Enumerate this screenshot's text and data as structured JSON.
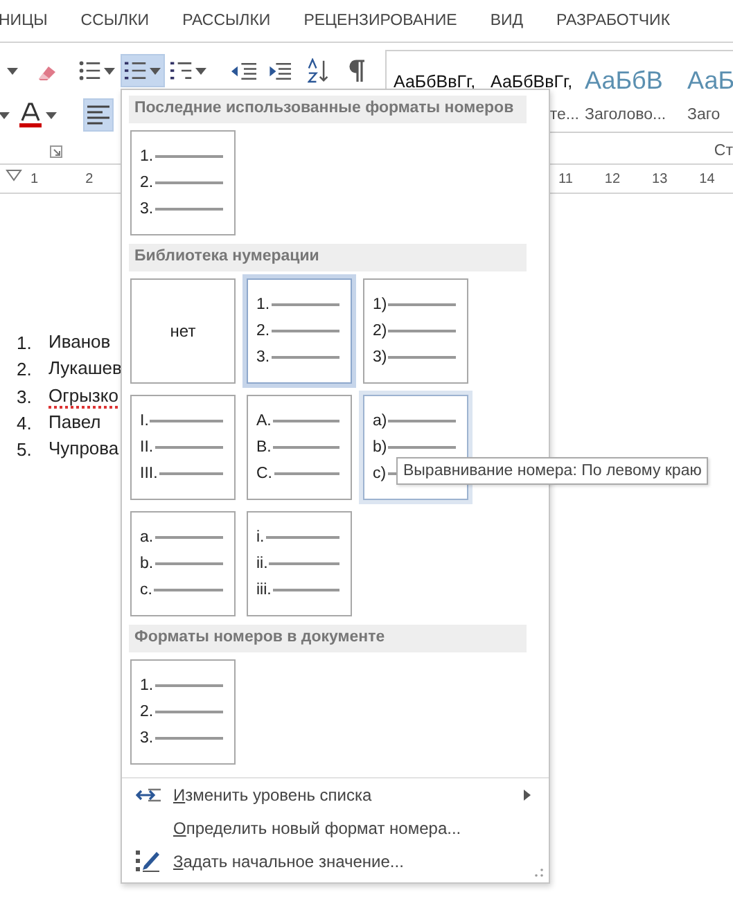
{
  "ribbon_tabs": [
    {
      "label": "НИЦЫ"
    },
    {
      "label": "ССЫЛКИ"
    },
    {
      "label": "РАССЫЛКИ"
    },
    {
      "label": "РЕЦЕНЗИРОВАНИЕ"
    },
    {
      "label": "ВИД"
    },
    {
      "label": "РАЗРАБОТЧИК"
    }
  ],
  "toolbar_row_1": [
    {
      "kind": "caret",
      "pressed": false
    },
    {
      "kind": "eraser",
      "pressed": false
    },
    {
      "kind": "bullets",
      "pressed": false
    },
    {
      "kind": "numbering",
      "pressed": true
    },
    {
      "kind": "multilevel",
      "pressed": false
    },
    {
      "kind": "outdent",
      "pressed": false
    },
    {
      "kind": "indent",
      "pressed": false
    },
    {
      "kind": "sort",
      "pressed": false
    },
    {
      "kind": "pilcrow",
      "pressed": false
    }
  ],
  "toolbar_row_2": [
    {
      "kind": "caret",
      "pressed": false
    },
    {
      "kind": "font-color",
      "pressed": false
    },
    {
      "kind": "align-left",
      "pressed": true
    }
  ],
  "styles_gallery": [
    {
      "sample": "АаБбВвГг,",
      "kind": "normal"
    },
    {
      "sample": "АаБбВвГг,",
      "label": "те...",
      "kind": "normal"
    },
    {
      "sample": "АаБбВ",
      "label": "Заголово...",
      "kind": "heading"
    },
    {
      "sample": "АаБ",
      "label": "Заго",
      "kind": "heading"
    }
  ],
  "styles_group_label": "Ст",
  "ruler": {
    "left_numbers": [
      "1",
      "2"
    ],
    "right_numbers": [
      "11",
      "12",
      "13",
      "14"
    ]
  },
  "document_list": [
    {
      "number": "1.",
      "text": "Иванов"
    },
    {
      "number": "2.",
      "text": "Лукашев"
    },
    {
      "number": "3.",
      "text": "Огрызко",
      "misspelled": true
    },
    {
      "number": "4.",
      "text": "Павел"
    },
    {
      "number": "5.",
      "text": "Чупрова"
    }
  ],
  "numbering_menu": {
    "recent": {
      "title": "Последние использованные форматы номеров",
      "tiles": [
        {
          "kind": "list",
          "markers": [
            "1.",
            "2.",
            "3."
          ],
          "selected": false,
          "hovered": false
        }
      ]
    },
    "library": {
      "title": "Библиотека нумерации",
      "tiles": [
        {
          "kind": "none",
          "label": "нет",
          "selected": false,
          "hovered": false
        },
        {
          "kind": "list",
          "markers": [
            "1.",
            "2.",
            "3."
          ],
          "selected": true,
          "hovered": false
        },
        {
          "kind": "list",
          "markers": [
            "1)",
            "2)",
            "3)"
          ],
          "selected": false,
          "hovered": false
        },
        {
          "kind": "list",
          "markers": [
            "I.",
            "II.",
            "III."
          ],
          "selected": false,
          "hovered": false
        },
        {
          "kind": "list",
          "markers": [
            "A.",
            "B.",
            "C."
          ],
          "selected": false,
          "hovered": false
        },
        {
          "kind": "list",
          "markers": [
            "a)",
            "b)",
            "c)"
          ],
          "selected": false,
          "hovered": true
        },
        {
          "kind": "list",
          "markers": [
            "a.",
            "b.",
            "c."
          ],
          "selected": false,
          "hovered": false
        },
        {
          "kind": "list",
          "markers": [
            "i.",
            "ii.",
            "iii."
          ],
          "selected": false,
          "hovered": false
        }
      ]
    },
    "document": {
      "title": "Форматы номеров в документе",
      "tiles": [
        {
          "kind": "list",
          "markers": [
            "1.",
            "2.",
            "3."
          ],
          "selected": false,
          "hovered": false
        }
      ]
    },
    "items": [
      {
        "label": "Изменить уровень списка",
        "kind": "level",
        "submenu": true
      },
      {
        "label": "Определить новый формат номера...",
        "kind": "define",
        "submenu": false
      },
      {
        "label": "Задать начальное значение...",
        "kind": "start",
        "submenu": false
      }
    ],
    "tooltip": "Выравнивание номера: По левому краю"
  }
}
